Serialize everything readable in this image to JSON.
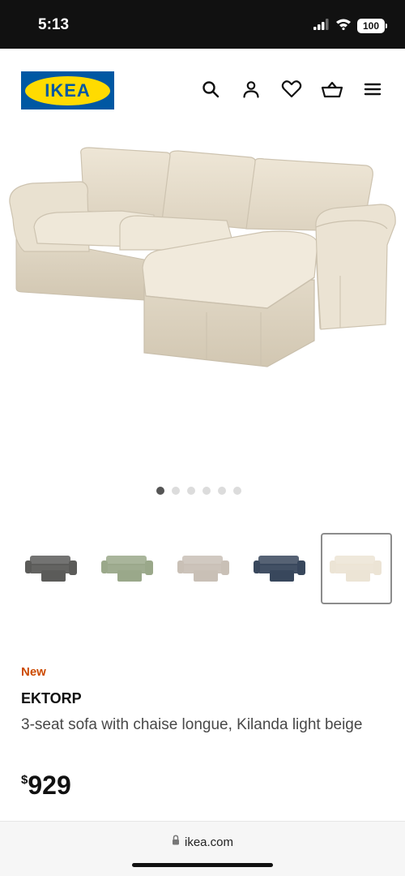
{
  "status_bar": {
    "time": "5:13",
    "battery": "100"
  },
  "header": {
    "logo_text": "IKEA",
    "icons": [
      "search-icon",
      "account-icon",
      "heart-icon",
      "cart-icon",
      "menu-icon"
    ]
  },
  "gallery": {
    "image_count": 6,
    "active_index": 0
  },
  "swatches": [
    {
      "name": "dark-grey",
      "color": "#5b5b59",
      "selected": false
    },
    {
      "name": "light-green",
      "color": "#9aa88a",
      "selected": false
    },
    {
      "name": "beige-grey",
      "color": "#c9c0b6",
      "selected": false
    },
    {
      "name": "dark-blue",
      "color": "#38475c",
      "selected": false
    },
    {
      "name": "light-beige",
      "color": "#ece4d5",
      "selected": true
    }
  ],
  "product": {
    "badge": "New",
    "name": "EKTORP",
    "description": "3-seat sofa with chaise longue, Kilanda light beige",
    "price_symbol": "$",
    "price": "929"
  },
  "browser": {
    "url": "ikea.com"
  },
  "colors": {
    "brand_blue": "#0058a3",
    "brand_yellow": "#ffdb00",
    "badge_orange": "#cc4a00"
  }
}
